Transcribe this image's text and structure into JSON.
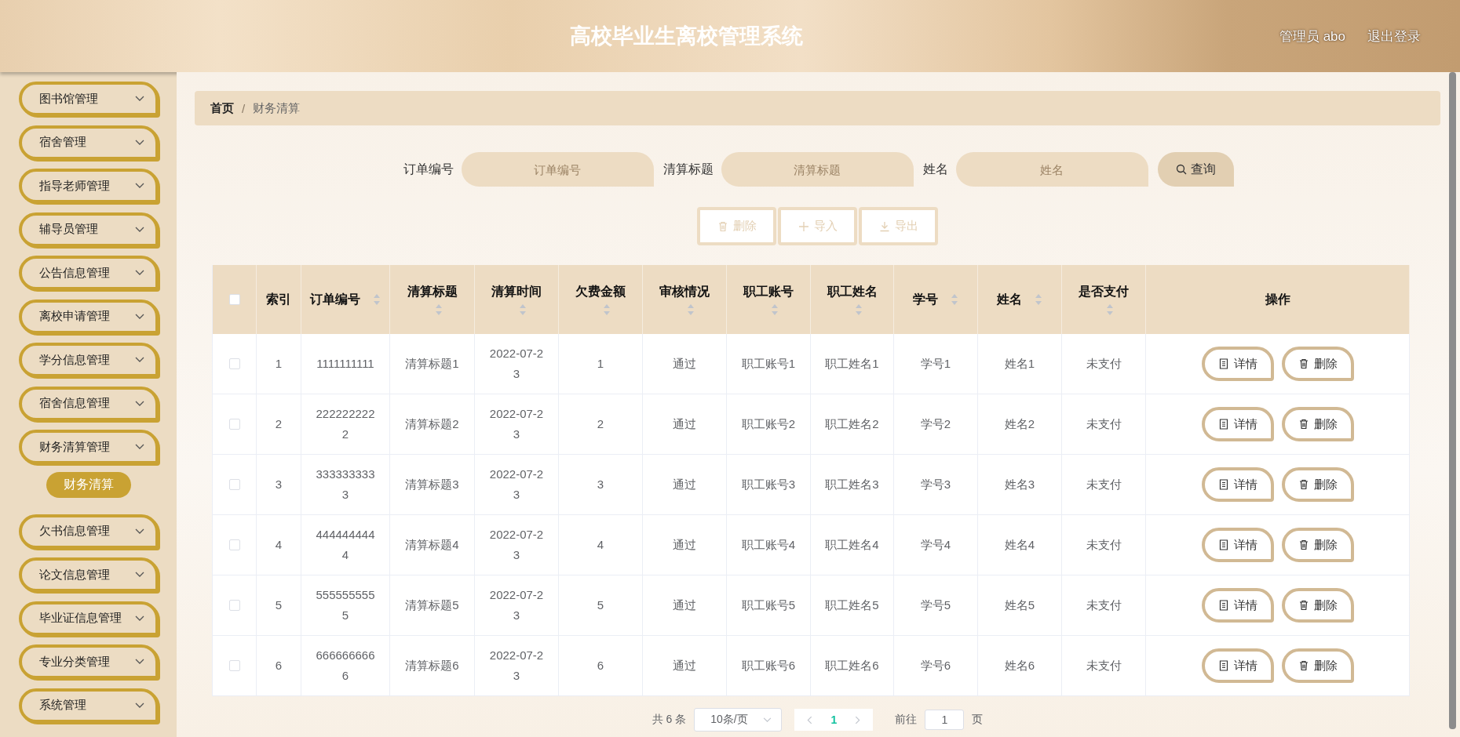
{
  "header": {
    "title": "高校毕业生离校管理系统",
    "user": "管理员 abo",
    "logout": "退出登录"
  },
  "sidebar": {
    "items": [
      {
        "label": "图书馆管理"
      },
      {
        "label": "宿舍管理"
      },
      {
        "label": "指导老师管理"
      },
      {
        "label": "辅导员管理"
      },
      {
        "label": "公告信息管理"
      },
      {
        "label": "离校申请管理"
      },
      {
        "label": "学分信息管理"
      },
      {
        "label": "宿舍信息管理"
      },
      {
        "label": "财务清算管理",
        "children": [
          {
            "label": "财务清算",
            "selected": true
          }
        ]
      },
      {
        "label": "欠书信息管理"
      },
      {
        "label": "论文信息管理"
      },
      {
        "label": "毕业证信息管理"
      },
      {
        "label": "专业分类管理"
      },
      {
        "label": "系统管理"
      }
    ]
  },
  "breadcrumb": {
    "separator": "/",
    "items": [
      {
        "label": "首页",
        "current": false
      },
      {
        "label": "财务清算",
        "current": true
      }
    ]
  },
  "search": {
    "fields": [
      {
        "label": "订单编号",
        "placeholder": "订单编号"
      },
      {
        "label": "清算标题",
        "placeholder": "清算标题"
      },
      {
        "label": "姓名",
        "placeholder": "姓名"
      }
    ],
    "button": "查询"
  },
  "toolbar": {
    "buttons": [
      {
        "kind": "delete",
        "label": "删除",
        "disabled": true
      },
      {
        "kind": "add",
        "label": "导入",
        "disabled": true
      },
      {
        "kind": "export",
        "label": "导出",
        "disabled": true
      }
    ]
  },
  "table": {
    "select_all": {
      "checked": false
    },
    "columns": [
      {
        "label": "索引",
        "sortable": false
      },
      {
        "label": "订单编号",
        "sortable": true
      },
      {
        "label": "清算标题",
        "sortable": true
      },
      {
        "label": "清算时间",
        "sortable": true
      },
      {
        "label": "欠费金额",
        "sortable": true
      },
      {
        "label": "审核情况",
        "sortable": true
      },
      {
        "label": "职工账号",
        "sortable": true
      },
      {
        "label": "职工姓名",
        "sortable": true
      },
      {
        "label": "学号",
        "sortable": true
      },
      {
        "label": "姓名",
        "sortable": true
      },
      {
        "label": "是否支付",
        "sortable": true
      },
      {
        "label": "操作",
        "sortable": false
      }
    ],
    "rows": [
      {
        "checked": false,
        "cells": [
          "1",
          "1111111111",
          "清算标题1",
          "2022-07-23",
          "1",
          "通过",
          "职工账号1",
          "职工姓名1",
          "学号1",
          "姓名1",
          "未支付"
        ],
        "actions": [
          {
            "kind": "detail",
            "label": "详情"
          },
          {
            "kind": "delete",
            "label": "删除"
          }
        ]
      },
      {
        "checked": false,
        "cells": [
          "2",
          "2222222222",
          "清算标题2",
          "2022-07-23",
          "2",
          "通过",
          "职工账号2",
          "职工姓名2",
          "学号2",
          "姓名2",
          "未支付"
        ],
        "actions": [
          {
            "kind": "detail",
            "label": "详情"
          },
          {
            "kind": "delete",
            "label": "删除"
          }
        ]
      },
      {
        "checked": false,
        "cells": [
          "3",
          "3333333333",
          "清算标题3",
          "2022-07-23",
          "3",
          "通过",
          "职工账号3",
          "职工姓名3",
          "学号3",
          "姓名3",
          "未支付"
        ],
        "actions": [
          {
            "kind": "detail",
            "label": "详情"
          },
          {
            "kind": "delete",
            "label": "删除"
          }
        ]
      },
      {
        "checked": false,
        "cells": [
          "4",
          "4444444444",
          "清算标题4",
          "2022-07-23",
          "4",
          "通过",
          "职工账号4",
          "职工姓名4",
          "学号4",
          "姓名4",
          "未支付"
        ],
        "actions": [
          {
            "kind": "detail",
            "label": "详情"
          },
          {
            "kind": "delete",
            "label": "删除"
          }
        ]
      },
      {
        "checked": false,
        "cells": [
          "5",
          "5555555555",
          "清算标题5",
          "2022-07-23",
          "5",
          "通过",
          "职工账号5",
          "职工姓名5",
          "学号5",
          "姓名5",
          "未支付"
        ],
        "actions": [
          {
            "kind": "detail",
            "label": "详情"
          },
          {
            "kind": "delete",
            "label": "删除"
          }
        ]
      },
      {
        "checked": false,
        "cells": [
          "6",
          "6666666666",
          "清算标题6",
          "2022-07-23",
          "6",
          "通过",
          "职工账号6",
          "职工姓名6",
          "学号6",
          "姓名6",
          "未支付"
        ],
        "actions": [
          {
            "kind": "detail",
            "label": "详情"
          },
          {
            "kind": "delete",
            "label": "删除"
          }
        ]
      }
    ]
  },
  "pagination": {
    "total": "共 6 条",
    "page_size": "10条/页",
    "pages": [
      {
        "label": "1",
        "selected": true
      }
    ],
    "goto_label": "前往",
    "goto_value": "1",
    "goto_suffix": "页"
  }
}
